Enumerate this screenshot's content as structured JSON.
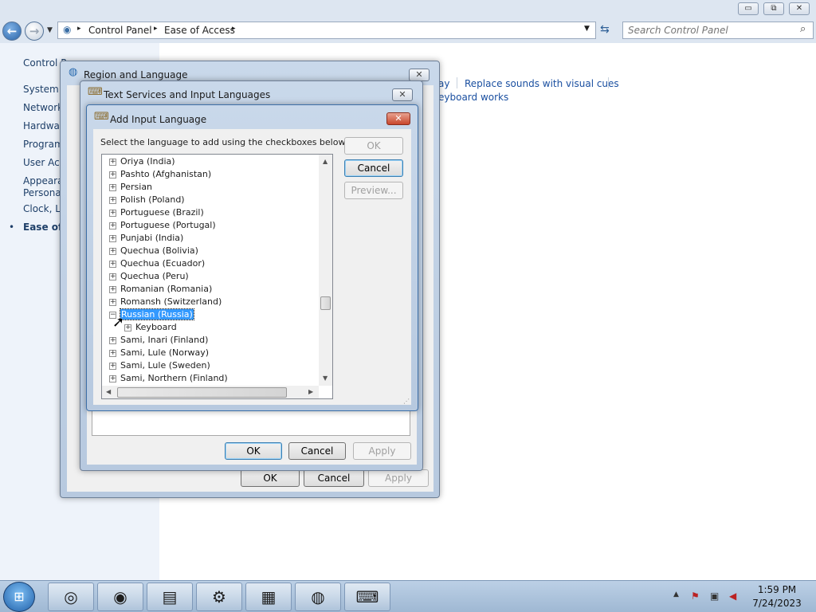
{
  "window": {
    "minimize_label": "▭",
    "maximize_label": "⧉",
    "close_label": "✕"
  },
  "address": {
    "segment1": "Control Panel",
    "segment2": "Ease of Access",
    "search_placeholder": "Search Control Panel"
  },
  "sidebar": {
    "items": [
      "Control P",
      "System a",
      "Network",
      "Hardwar",
      "Program",
      "User Acc",
      "Appearar",
      "Personal",
      "Clock, La",
      "Ease of A"
    ]
  },
  "main": {
    "links": [
      "ay",
      "Replace sounds with visual cues",
      "eyboard works"
    ]
  },
  "region_dialog": {
    "title": "Region and Language",
    "ok": "OK",
    "cancel": "Cancel",
    "apply": "Apply"
  },
  "text_services_dialog": {
    "title": "Text Services and Input Languages",
    "ok": "OK",
    "cancel": "Cancel",
    "apply": "Apply"
  },
  "add_language_dialog": {
    "title": "Add Input Language",
    "instruction": "Select the language to add using the checkboxes below.",
    "ok": "OK",
    "cancel": "Cancel",
    "preview": "Preview...",
    "languages": [
      "Oriya (India)",
      "Pashto (Afghanistan)",
      "Persian",
      "Polish (Poland)",
      "Portuguese (Brazil)",
      "Portuguese (Portugal)",
      "Punjabi (India)",
      "Quechua (Bolivia)",
      "Quechua (Ecuador)",
      "Quechua (Peru)",
      "Romanian (Romania)",
      "Romansh (Switzerland)",
      "Russian (Russia)",
      "Keyboard",
      "Sami, Inari (Finland)",
      "Sami, Lule (Norway)",
      "Sami, Lule (Sweden)",
      "Sami, Northern (Finland)"
    ],
    "selected_item": "Russian (Russia)"
  },
  "taskbar": {
    "apps": [
      "chrome-icon",
      "firefox-icon",
      "file-explorer-icon",
      "steam-icon",
      "control-panel-icon",
      "region-globe-icon",
      "keyboard-language-icon"
    ],
    "time": "1:59 PM",
    "date": "7/24/2023"
  },
  "colors": {
    "selection": "#3399ff",
    "link": "#1a4fa0",
    "close_red": "#c8462c"
  }
}
